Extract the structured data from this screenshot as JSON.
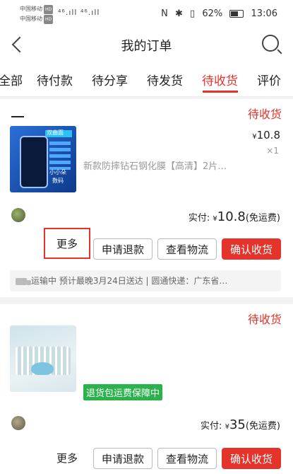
{
  "status_bar": {
    "carrier1": "中国移动",
    "carrier2": "中国移动",
    "hd_badge": "HD",
    "signal_label": "⁴⁶.ıll ⁴⁶.ıll",
    "nfc": "N",
    "bluetooth": "✱",
    "vibrate": "▯",
    "battery_pct": "62%",
    "time": "13:06"
  },
  "header": {
    "title": "我的订单"
  },
  "tabs": [
    {
      "label": "全部",
      "active": false
    },
    {
      "label": "待付款",
      "active": false
    },
    {
      "label": "待分享",
      "active": false
    },
    {
      "label": "待发货",
      "active": false
    },
    {
      "label": "待收货",
      "active": true
    },
    {
      "label": "评价",
      "active": false
    }
  ],
  "orders": [
    {
      "status": "待收货",
      "image_text": [
        "双曲面",
        "小小朵",
        "数码"
      ],
      "price_symbol": "¥",
      "price": "10.8",
      "qty": "×1",
      "product_name": "新款防摔钻石钢化膜【高清】2片…",
      "paid_label": "实付:",
      "paid_symbol": "¥",
      "paid_amount": "10.8",
      "shipping_note": "(免运费)",
      "buttons": {
        "more": "更多",
        "refund": "申请退款",
        "logistics": "查看物流",
        "confirm": "确认收货"
      },
      "logistics_text": "运输中 预计最晚3月24日送达 | 圆通快递：广东省…"
    },
    {
      "status": "待收货",
      "badge": "退货包运费保障中",
      "paid_label": "实付:",
      "paid_symbol": "¥",
      "paid_amount": "35",
      "shipping_note": "(免运费)",
      "buttons": {
        "more": "更多",
        "refund": "申请退款",
        "logistics": "查看物流",
        "confirm": "确认收货"
      }
    }
  ],
  "colors": {
    "accent": "#e3332b",
    "badge_green": "#2bb24c"
  }
}
